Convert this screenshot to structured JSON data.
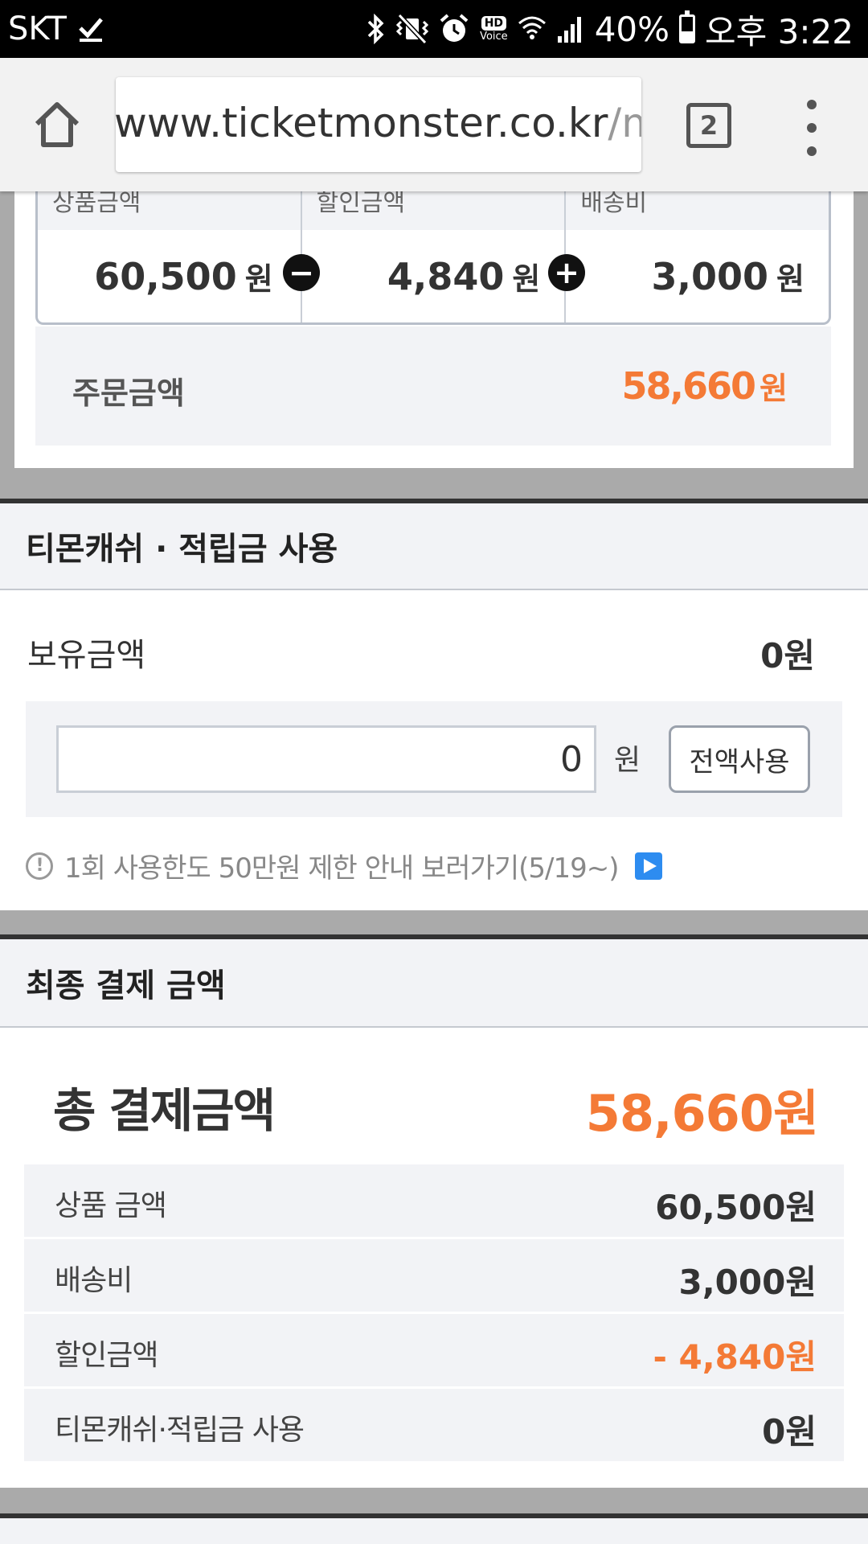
{
  "status_bar": {
    "carrier": "SKT",
    "battery": "40%",
    "battery_level": 0.4,
    "hd_label": "HD",
    "voice_label": "Voice",
    "time": "오후 3:22"
  },
  "browser": {
    "url_main": "www.ticketmonster.co.kr",
    "url_dim": "/m",
    "tab_count": "2"
  },
  "order_summary": {
    "product_header": "상품금액",
    "discount_header": "할인금액",
    "shipping_header": "배송비",
    "product_value": "60,500",
    "discount_value": "4,840",
    "shipping_value": "3,000",
    "unit": "원",
    "order_label": "주문금액",
    "order_value": "58,660",
    "accent_color": "#f47a36"
  },
  "cash_section": {
    "title": "티몬캐쉬 · 적립금 사용",
    "hold_label": "보유금액",
    "hold_value": "0원",
    "input_value": "0",
    "unit": "원",
    "use_all_label": "전액사용",
    "notice": "1회 사용한도 50만원 제한 안내 보러가기(5/19~)"
  },
  "final_section": {
    "title": "최종 결제 금액",
    "total_label": "총 결제금액",
    "total_value": "58,660원",
    "rows": [
      {
        "label": "상품 금액",
        "value": "60,500원"
      },
      {
        "label": "배송비",
        "value": "3,000원"
      },
      {
        "label": "할인금액",
        "value": "- 4,840원"
      },
      {
        "label": "티몬캐쉬·적립금 사용",
        "value": "0원"
      }
    ]
  }
}
